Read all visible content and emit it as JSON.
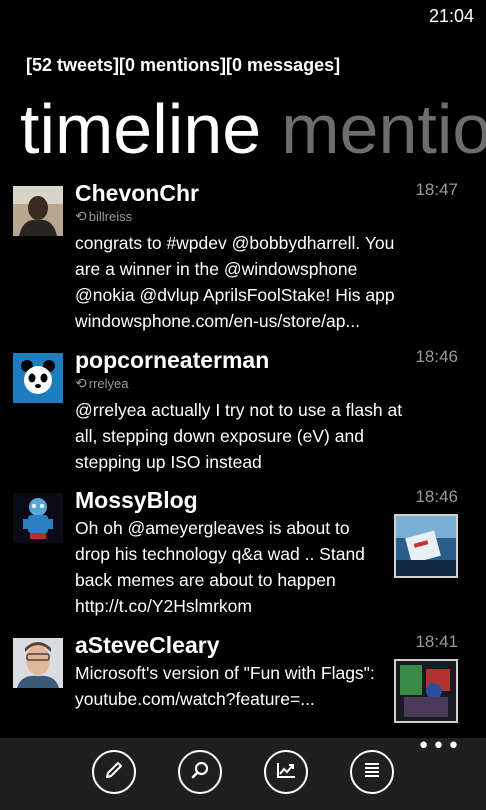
{
  "status": {
    "time": "21:04"
  },
  "counts": "[52 tweets][0 mentions][0 messages]",
  "pivot": {
    "active": "timeline",
    "next": "mentio"
  },
  "tweets": [
    {
      "user": "ChevonChr",
      "retweeted_by": "billreiss",
      "time": "18:47",
      "text": "congrats to #wpdev @bobbydharrell. You are a winner in the @windowsphone @nokia @dvlup AprilsFoolStake! His app windowsphone.com/en-us/store/ap...",
      "avatar_icon": "avatar-man-photo"
    },
    {
      "user": "popcorneaterman",
      "retweeted_by": "rrelyea",
      "time": "18:46",
      "text": "@rrelyea actually I try not to use a flash at all, stepping down exposure (eV) and stepping up ISO instead",
      "avatar_icon": "panda-icon"
    },
    {
      "user": "MossyBlog",
      "time": "18:46",
      "text": "Oh oh @ameyergleaves is about to drop his technology q&a wad .. Stand back memes are about to happen http://t.co/Y2Hslmrkom",
      "avatar_icon": "robot-icon",
      "has_thumbnail": true
    },
    {
      "user": "aSteveCleary",
      "time": "18:41",
      "text": "Microsoft's version of \"Fun with Flags\": youtube.com/watch?feature=...",
      "avatar_icon": "avatar-man-photo",
      "has_thumbnail": true
    }
  ],
  "app_bar": {
    "buttons": [
      "compose-icon",
      "search-icon",
      "chart-icon",
      "list-icon"
    ],
    "more": "•••"
  },
  "colors": {
    "background": "#000000",
    "secondary_text": "#9a9a9a",
    "app_bar": "#1f1f1f"
  }
}
